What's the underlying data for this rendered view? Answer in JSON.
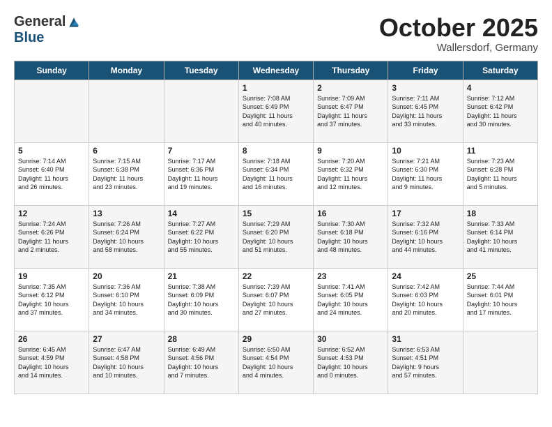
{
  "header": {
    "logo_general": "General",
    "logo_blue": "Blue",
    "month": "October 2025",
    "location": "Wallersdorf, Germany"
  },
  "weekdays": [
    "Sunday",
    "Monday",
    "Tuesday",
    "Wednesday",
    "Thursday",
    "Friday",
    "Saturday"
  ],
  "weeks": [
    [
      {
        "day": "",
        "info": ""
      },
      {
        "day": "",
        "info": ""
      },
      {
        "day": "",
        "info": ""
      },
      {
        "day": "1",
        "info": "Sunrise: 7:08 AM\nSunset: 6:49 PM\nDaylight: 11 hours\nand 40 minutes."
      },
      {
        "day": "2",
        "info": "Sunrise: 7:09 AM\nSunset: 6:47 PM\nDaylight: 11 hours\nand 37 minutes."
      },
      {
        "day": "3",
        "info": "Sunrise: 7:11 AM\nSunset: 6:45 PM\nDaylight: 11 hours\nand 33 minutes."
      },
      {
        "day": "4",
        "info": "Sunrise: 7:12 AM\nSunset: 6:42 PM\nDaylight: 11 hours\nand 30 minutes."
      }
    ],
    [
      {
        "day": "5",
        "info": "Sunrise: 7:14 AM\nSunset: 6:40 PM\nDaylight: 11 hours\nand 26 minutes."
      },
      {
        "day": "6",
        "info": "Sunrise: 7:15 AM\nSunset: 6:38 PM\nDaylight: 11 hours\nand 23 minutes."
      },
      {
        "day": "7",
        "info": "Sunrise: 7:17 AM\nSunset: 6:36 PM\nDaylight: 11 hours\nand 19 minutes."
      },
      {
        "day": "8",
        "info": "Sunrise: 7:18 AM\nSunset: 6:34 PM\nDaylight: 11 hours\nand 16 minutes."
      },
      {
        "day": "9",
        "info": "Sunrise: 7:20 AM\nSunset: 6:32 PM\nDaylight: 11 hours\nand 12 minutes."
      },
      {
        "day": "10",
        "info": "Sunrise: 7:21 AM\nSunset: 6:30 PM\nDaylight: 11 hours\nand 9 minutes."
      },
      {
        "day": "11",
        "info": "Sunrise: 7:23 AM\nSunset: 6:28 PM\nDaylight: 11 hours\nand 5 minutes."
      }
    ],
    [
      {
        "day": "12",
        "info": "Sunrise: 7:24 AM\nSunset: 6:26 PM\nDaylight: 11 hours\nand 2 minutes."
      },
      {
        "day": "13",
        "info": "Sunrise: 7:26 AM\nSunset: 6:24 PM\nDaylight: 10 hours\nand 58 minutes."
      },
      {
        "day": "14",
        "info": "Sunrise: 7:27 AM\nSunset: 6:22 PM\nDaylight: 10 hours\nand 55 minutes."
      },
      {
        "day": "15",
        "info": "Sunrise: 7:29 AM\nSunset: 6:20 PM\nDaylight: 10 hours\nand 51 minutes."
      },
      {
        "day": "16",
        "info": "Sunrise: 7:30 AM\nSunset: 6:18 PM\nDaylight: 10 hours\nand 48 minutes."
      },
      {
        "day": "17",
        "info": "Sunrise: 7:32 AM\nSunset: 6:16 PM\nDaylight: 10 hours\nand 44 minutes."
      },
      {
        "day": "18",
        "info": "Sunrise: 7:33 AM\nSunset: 6:14 PM\nDaylight: 10 hours\nand 41 minutes."
      }
    ],
    [
      {
        "day": "19",
        "info": "Sunrise: 7:35 AM\nSunset: 6:12 PM\nDaylight: 10 hours\nand 37 minutes."
      },
      {
        "day": "20",
        "info": "Sunrise: 7:36 AM\nSunset: 6:10 PM\nDaylight: 10 hours\nand 34 minutes."
      },
      {
        "day": "21",
        "info": "Sunrise: 7:38 AM\nSunset: 6:09 PM\nDaylight: 10 hours\nand 30 minutes."
      },
      {
        "day": "22",
        "info": "Sunrise: 7:39 AM\nSunset: 6:07 PM\nDaylight: 10 hours\nand 27 minutes."
      },
      {
        "day": "23",
        "info": "Sunrise: 7:41 AM\nSunset: 6:05 PM\nDaylight: 10 hours\nand 24 minutes."
      },
      {
        "day": "24",
        "info": "Sunrise: 7:42 AM\nSunset: 6:03 PM\nDaylight: 10 hours\nand 20 minutes."
      },
      {
        "day": "25",
        "info": "Sunrise: 7:44 AM\nSunset: 6:01 PM\nDaylight: 10 hours\nand 17 minutes."
      }
    ],
    [
      {
        "day": "26",
        "info": "Sunrise: 6:45 AM\nSunset: 4:59 PM\nDaylight: 10 hours\nand 14 minutes."
      },
      {
        "day": "27",
        "info": "Sunrise: 6:47 AM\nSunset: 4:58 PM\nDaylight: 10 hours\nand 10 minutes."
      },
      {
        "day": "28",
        "info": "Sunrise: 6:49 AM\nSunset: 4:56 PM\nDaylight: 10 hours\nand 7 minutes."
      },
      {
        "day": "29",
        "info": "Sunrise: 6:50 AM\nSunset: 4:54 PM\nDaylight: 10 hours\nand 4 minutes."
      },
      {
        "day": "30",
        "info": "Sunrise: 6:52 AM\nSunset: 4:53 PM\nDaylight: 10 hours\nand 0 minutes."
      },
      {
        "day": "31",
        "info": "Sunrise: 6:53 AM\nSunset: 4:51 PM\nDaylight: 9 hours\nand 57 minutes."
      },
      {
        "day": "",
        "info": ""
      }
    ]
  ]
}
